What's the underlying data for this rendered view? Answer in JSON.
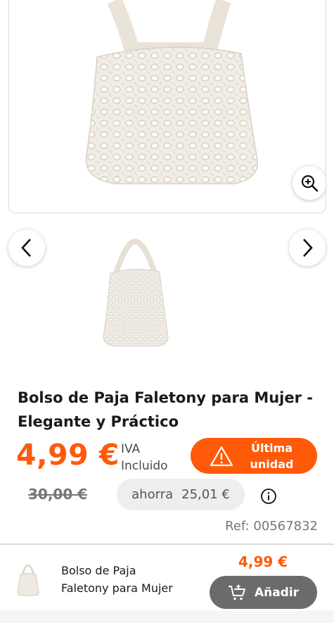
{
  "gallery": {
    "zoom_icon": "zoom-in-icon",
    "prev_icon": "chevron-left-icon",
    "next_icon": "chevron-right-icon"
  },
  "product": {
    "title": "Bolso de Paja Faletony para Mujer - Elegante y Práctico",
    "price": "4,99 €",
    "iva_line1": "IVA",
    "iva_line2": "Incluido",
    "badge_line1": "Última",
    "badge_line2": "unidad",
    "old_price": "30,00 €",
    "savings_label": "ahorra",
    "savings_value": "25,01 €",
    "ref": "Ref: 00567832"
  },
  "sticky": {
    "name_line1": "Bolso de Paja",
    "name_line2": "Faletony para Mujer",
    "price": "4,99 €",
    "add_label": "Añadir"
  },
  "colors": {
    "accent": "#ff5a0a",
    "button_gray": "#6b6b6b"
  }
}
